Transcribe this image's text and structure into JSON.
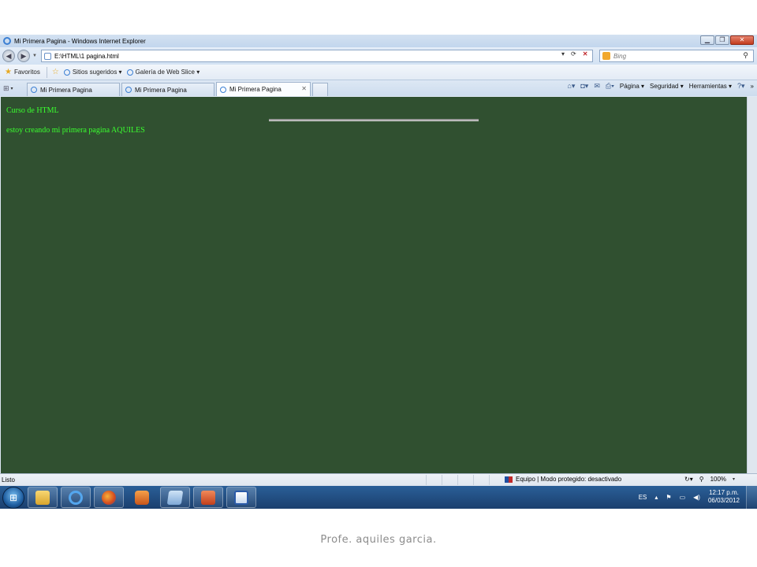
{
  "window": {
    "title": "Mi Primera Pagina - Windows Internet Explorer",
    "minimize": "▁",
    "maximize": "❐",
    "close": "✕"
  },
  "address_bar": {
    "url": "E:\\HTML\\1 pagina.html",
    "search_placeholder": "Bing"
  },
  "favorites_bar": {
    "favorites_label": "Favoritos",
    "items": [
      {
        "label": "Sitios sugeridos ▾"
      },
      {
        "label": "Galería de Web Slice ▾"
      }
    ]
  },
  "tabs": [
    {
      "label": "Mi Primera Pagina"
    },
    {
      "label": "Mi Primera Pagina"
    },
    {
      "label": "Mi Primera Pagina",
      "active": true
    }
  ],
  "command_bar": {
    "page": "Página ▾",
    "security": "Seguridad ▾",
    "tools": "Herramientas ▾"
  },
  "page_content": {
    "heading": "Curso de HTML",
    "body": "estoy creando mi primera pagina AQUILES",
    "background_color": "#305030",
    "text_color": "#3aff2f"
  },
  "status_bar": {
    "status": "Listo",
    "zone": "Equipo | Modo protegido: desactivado",
    "zoom": "100%"
  },
  "taskbar": {
    "language": "ES",
    "time": "12:17 p.m.",
    "date": "06/03/2012",
    "apps": [
      "folder-icon",
      "internet-explorer-icon",
      "firefox-icon",
      "media-player-icon",
      "document-icon",
      "powerpoint-icon",
      "word-icon"
    ]
  },
  "caption": "Profe. aquiles garcia."
}
